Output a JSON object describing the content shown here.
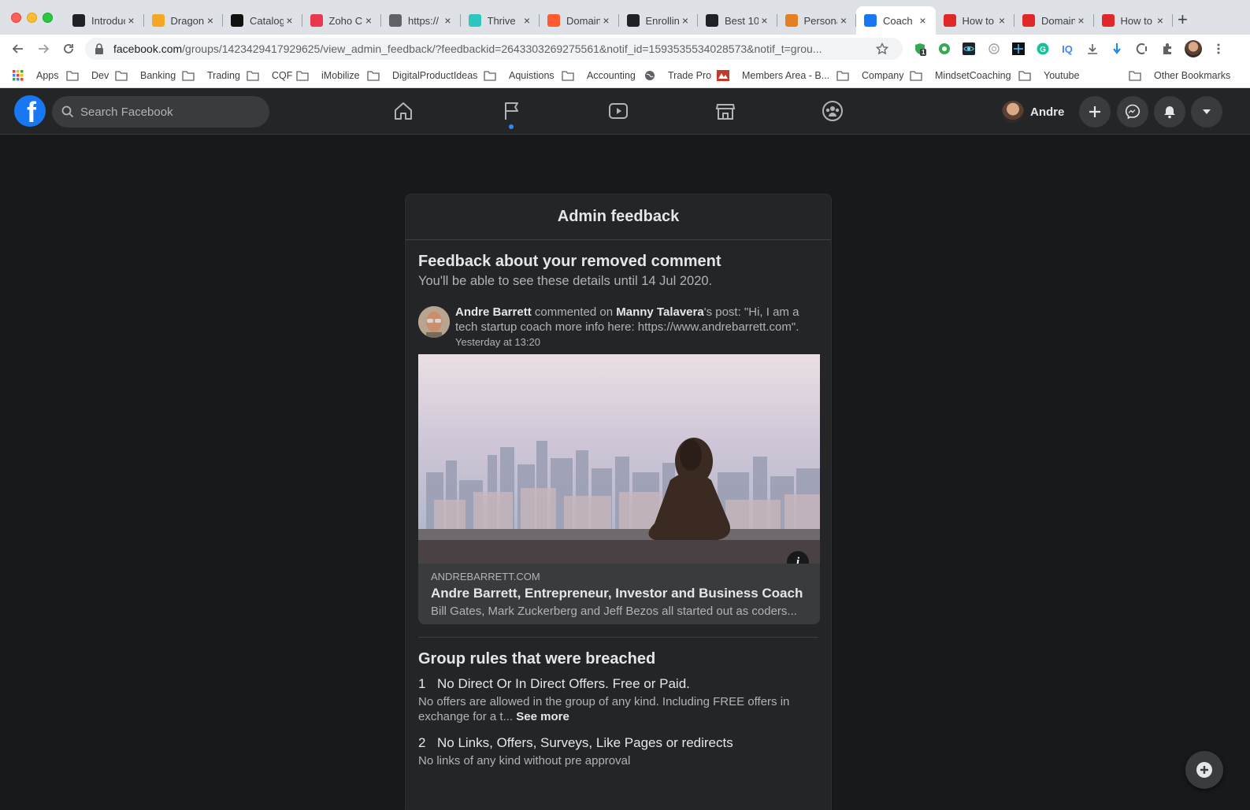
{
  "browser": {
    "tabs": [
      {
        "title": "Introduction",
        "favicon": "terminal-icon",
        "color": "#202124"
      },
      {
        "title": "Dragon",
        "favicon": "dragon-icon",
        "color": "#f5a623"
      },
      {
        "title": "Catalog",
        "favicon": "fm-icon",
        "color": "#111111"
      },
      {
        "title": "Zoho C",
        "favicon": "megaphone-icon",
        "color": "#e8384f"
      },
      {
        "title": "https://",
        "favicon": "globe-icon",
        "color": "#5f6368"
      },
      {
        "title": "Thrive",
        "favicon": "thrive-icon",
        "color": "#2ec7c0"
      },
      {
        "title": "Domain",
        "favicon": "chart-icon",
        "color": "#ff5b2e"
      },
      {
        "title": "Enrolling",
        "favicon": "terminal-icon",
        "color": "#202124"
      },
      {
        "title": "Best 10",
        "favicon": "building-icon",
        "color": "#202124"
      },
      {
        "title": "Personal",
        "favicon": "flag-icon",
        "color": "#e67e22"
      },
      {
        "title": "Coach",
        "favicon": "facebook-icon",
        "color": "#1877f2",
        "active": true
      },
      {
        "title": "How to",
        "favicon": "z-icon",
        "color": "#e02828"
      },
      {
        "title": "Domain",
        "favicon": "z-icon",
        "color": "#e02828"
      },
      {
        "title": "How to",
        "favicon": "z-icon",
        "color": "#e02828"
      }
    ],
    "url_host": "facebook.com",
    "url_path": "/groups/1423429417929625/view_admin_feedback/?feedbackid=2643303269275561&notif_id=1593535534028573&notif_t=grou...",
    "extension_badge": "1",
    "bookmarks": [
      {
        "label": "Apps",
        "icon": "apps-grid-icon"
      },
      {
        "label": "Dev",
        "icon": "folder-icon"
      },
      {
        "label": "Banking",
        "icon": "folder-icon"
      },
      {
        "label": "Trading",
        "icon": "folder-icon"
      },
      {
        "label": "CQF",
        "icon": "folder-icon"
      },
      {
        "label": "iMobilize",
        "icon": "folder-icon"
      },
      {
        "label": "DigitalProductIdeas",
        "icon": "folder-icon"
      },
      {
        "label": "Aquistions",
        "icon": "folder-icon"
      },
      {
        "label": "Accounting",
        "icon": "folder-icon"
      },
      {
        "label": "Trade Pro",
        "icon": "globe-icon"
      },
      {
        "label": "Members Area - B...",
        "icon": "site-icon"
      },
      {
        "label": "Company",
        "icon": "folder-icon"
      },
      {
        "label": "MindsetCoaching",
        "icon": "folder-icon"
      },
      {
        "label": "Youtube",
        "icon": "folder-icon"
      },
      {
        "label": "Other Bookmarks",
        "icon": "folder-icon"
      }
    ]
  },
  "facebook": {
    "search_placeholder": "Search Facebook",
    "user_name": "Andre",
    "brand_color": "#1877f2"
  },
  "feedback": {
    "header": "Admin feedback",
    "title": "Feedback about your removed comment",
    "subtitle": "You'll be able to see these details until 14 Jul 2020.",
    "comment": {
      "author": "Andre Barrett",
      "action": " commented on ",
      "target": "Manny Talavera",
      "text": "'s post: \"Hi, I am a tech startup coach more info here: https://www.andrebarrett.com\".",
      "time": "Yesterday at 13:20"
    },
    "link": {
      "domain": "ANDREBARRETT.COM",
      "title": "Andre Barrett, Entrepreneur, Investor and Business Coach",
      "description": "Bill Gates, Mark Zuckerberg and Jeff Bezos all started out as coders..."
    },
    "rules_title": "Group rules that were breached",
    "rules": [
      {
        "number": "1",
        "title": "No Direct Or In Direct Offers. Free or Paid.",
        "body": "No offers are allowed in the group of any kind. Including FREE offers in exchange for a t...",
        "see_more": "See more"
      },
      {
        "number": "2",
        "title": "No Links, Offers, Surveys, Like Pages or redirects",
        "body": "No links of any kind without pre approval"
      }
    ]
  }
}
